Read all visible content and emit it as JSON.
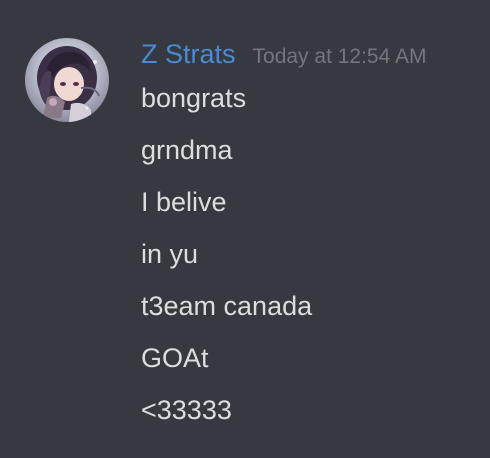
{
  "message_group": {
    "author": {
      "username": "Z Strats",
      "username_color": "#4a8ad4",
      "avatar_icon": "user-avatar-anime-character"
    },
    "timestamp": "Today at 12:54 AM",
    "messages": [
      "bongrats",
      "grndma",
      "I belive",
      "in yu",
      "t3eam canada",
      "GOAt",
      "<33333"
    ]
  },
  "colors": {
    "background": "#36393f",
    "message_text": "#dcddde",
    "timestamp_text": "#72767d"
  }
}
